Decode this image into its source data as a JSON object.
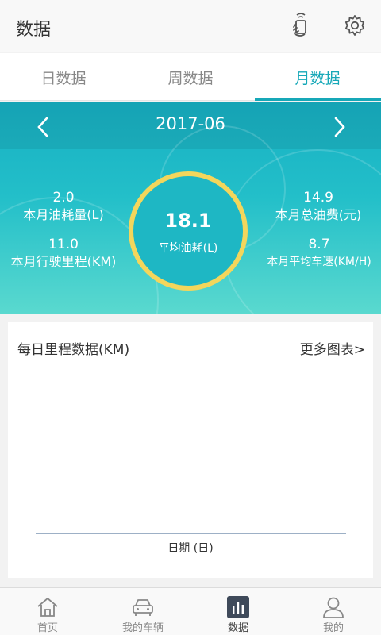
{
  "header": {
    "title": "数据",
    "icons": [
      "phone-hand-icon",
      "gear-icon"
    ]
  },
  "tabs": [
    {
      "label": "日数据",
      "active": false
    },
    {
      "label": "周数据",
      "active": false
    },
    {
      "label": "月数据",
      "active": true
    }
  ],
  "summary": {
    "month": "2017-06",
    "fuel_consumption": {
      "value": "2.0",
      "label": "本月油耗量(L)"
    },
    "mileage": {
      "value": "11.0",
      "label": "本月行驶里程(KM)"
    },
    "avg_fuel": {
      "value": "18.1",
      "label": "平均油耗(L)"
    },
    "total_fuel_cost": {
      "value": "14.9",
      "label": "本月总油费(元)"
    },
    "avg_speed": {
      "value": "8.7",
      "label": "本月平均车速(KM/H)"
    }
  },
  "chart": {
    "title": "每日里程数据(KM)",
    "more_link": "更多图表>",
    "xlabel": "日期 (日)"
  },
  "bottom_nav": [
    {
      "label": "首页",
      "icon": "home-icon",
      "active": false
    },
    {
      "label": "我的车辆",
      "icon": "car-icon",
      "active": false
    },
    {
      "label": "数据",
      "icon": "bar-chart-icon",
      "active": true
    },
    {
      "label": "我的",
      "icon": "person-icon",
      "active": false
    }
  ],
  "colors": {
    "accent": "#16a8b8",
    "ring": "#f3d65c",
    "hero_top": "#17b0c3",
    "hero_bottom": "#5ad9cf"
  }
}
